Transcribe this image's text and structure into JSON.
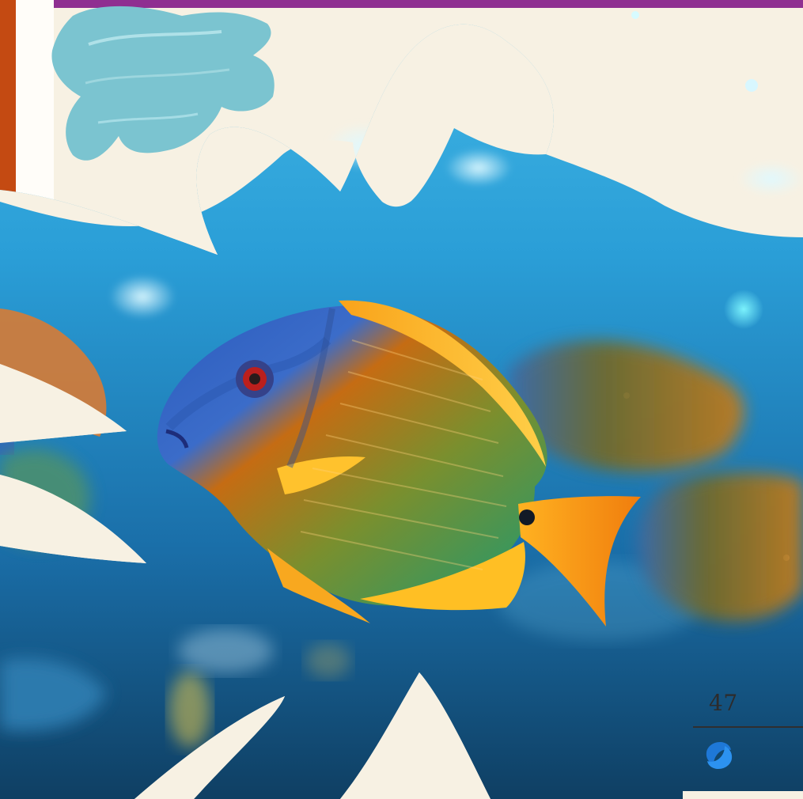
{
  "page": {
    "page_number": "47",
    "accent_color": "#8f2f91",
    "logo_name": "publisher-logo"
  },
  "image": {
    "description_tokens": {
      "fish_blue": "#2b5bbd",
      "fish_orange": "#f59b23",
      "water_light": "#71d2ff",
      "water_dark": "#0b6aa8"
    }
  }
}
